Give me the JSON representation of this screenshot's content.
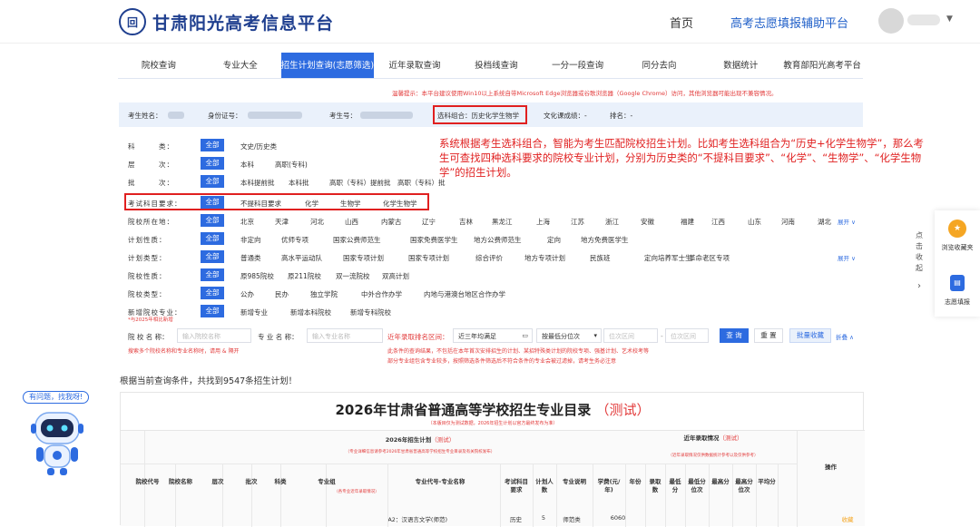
{
  "header": {
    "logo_glyph": "回",
    "title": "甘肃阳光高考信息平台",
    "nav": [
      "首页",
      "高考志愿填报辅助平台"
    ]
  },
  "tabs": [
    {
      "label": "院校查询",
      "active": false
    },
    {
      "label": "专业大全",
      "active": false
    },
    {
      "label": "招生计划查询(志愿筛选)",
      "active": true
    },
    {
      "label": "近年录取查询",
      "active": false
    },
    {
      "label": "投档线查询",
      "active": false
    },
    {
      "label": "一分一段查询",
      "active": false
    },
    {
      "label": "同分去向",
      "active": false
    },
    {
      "label": "数据统计",
      "active": false
    },
    {
      "label": "教育部阳光高考平台",
      "active": false
    }
  ],
  "notice": "温馨提示：本平台建议使用Win10以上系统自带Microsoft Edge浏览器或谷歌浏览器（Google Chrome）访问，其他浏览器可能出现不兼容情况。",
  "student_info": {
    "name_label": "考生姓名：",
    "id_label": "身份证号：",
    "exam_label": "考生号：",
    "subject_combo": "选科组合：历史化学生物学",
    "culture_score": "文化课成绩：-",
    "rank": "排名：-"
  },
  "explanation": "系统根据考生选科组合，智能为考生匹配院校招生计划。比如考生选科组合为“历史+化学生物学”，那么考生可查找四种选科要求的院校专业计划，分别为历史类的“不提科目要求”、“化学”、“生物学”、“化学生物学”的招生计划。",
  "filters": [
    {
      "label": "科　　　类：",
      "all": "全部",
      "options": [
        "文史/历史类"
      ]
    },
    {
      "label": "层　　　次：",
      "all": "全部",
      "options": [
        "本科",
        "高职(专科)"
      ]
    },
    {
      "label": "批　　　次：",
      "all": "全部",
      "options": [
        "本科提前批",
        "本科批",
        "高职（专科）提前批",
        "高职（专科）批"
      ]
    },
    {
      "label": "考试科目要求：",
      "all": "全部",
      "options": [
        "不提科目要求",
        "化学",
        "生物学",
        "化学生物学"
      ]
    },
    {
      "label": "院校所在地：",
      "all": "全部",
      "options": [
        "北京",
        "天津",
        "河北",
        "山西",
        "内蒙古",
        "辽宁",
        "吉林",
        "黑龙江",
        "上海",
        "江苏",
        "浙江",
        "安徽",
        "福建",
        "江西",
        "山东",
        "河南",
        "湖北"
      ],
      "more": "展开 ∨"
    },
    {
      "label": "计划性质：",
      "all": "全部",
      "options": [
        "非定向",
        "优师专项",
        "国家公费师范生",
        "国家免费医学生",
        "地方公费师范生",
        "定向",
        "地方免费医学生"
      ]
    },
    {
      "label": "计划类型：",
      "all": "全部",
      "options": [
        "普通类",
        "高水平运动队",
        "国家专项计划",
        "国家专项计划",
        "综合评价",
        "地方专项计划",
        "民族班",
        "定向培养军士生",
        "革命老区专项"
      ],
      "more": "展开 ∨"
    },
    {
      "label": "院校性质：",
      "all": "全部",
      "options": [
        "原985院校",
        "原211院校",
        "双一流院校",
        "双高计划"
      ]
    },
    {
      "label": "院校类型：",
      "all": "全部",
      "options": [
        "公办",
        "民办",
        "独立学院",
        "中外合作办学",
        "内地与港澳台地区合作办学"
      ]
    },
    {
      "label": "新增院校专业：",
      "all": "全部",
      "options": [
        "新增专业",
        "新增本科院校",
        "新增专科院校"
      ]
    }
  ],
  "filter_sub_note": "*与2025年相比新增",
  "search": {
    "school_label": "院 校 名 称：",
    "school_placeholder": "输入院校名称",
    "major_label": "专 业 名 称：",
    "major_placeholder": "输入专业名称",
    "range_label": "近年录取排名区间：",
    "range_value": "近三年均满足",
    "sort_value": "按最低分位次",
    "rank_placeholder": "位次区间",
    "rank_placeholder2": "位次区间",
    "query": "查 询",
    "reset": "重 置",
    "batch": "批量收藏",
    "collapse": "折叠 ∧",
    "hint1": "搜索多个院校名称和专业名称时，请用 & 隔开",
    "hint2": "此条件的查询结果，不包括在本年首次安排招生的计划、某招特殊类计划的院校专项、强基计划、艺术校考等",
    "hint3": "部分专业组包含专业较多，按照筛选条件筛选后不符合条件的专业会被过滤掉，请考生务必注意"
  },
  "result_text": "根据当前查询条件，共找到9547条招生计划！",
  "table": {
    "title": "2026年甘肃省普通高等学校招生专业目录",
    "title_test": "（测试）",
    "subtitle": "（本版目仅为测试数据，2026年招生计划以官方最终发布为准）",
    "plan_header": "2026年招生计划",
    "plan_header_test": "（测试）",
    "plan_note": "（专业详细信息请参考2026年甘肃省普通高等学校招生专业目录及有关院校发布）",
    "recent_header": "近年录取情况",
    "recent_header_test": "（测试）",
    "recent_note": "（近年录取情况仅供数据统计参考以及仅供参考）",
    "major_group_note": "（各专业近年录取情况）",
    "operation": "操作",
    "columns": [
      "院校代号",
      "院校名称",
      "层次",
      "批次",
      "科类",
      "专业组",
      "专业代号-专业名称",
      "考试科目要求",
      "计划人数",
      "专业说明",
      "学费(元/年)",
      "年份",
      "录取数",
      "最低分",
      "最低分位次",
      "最高分",
      "最高分位次",
      "平均分"
    ],
    "row": {
      "major": "A2：汉语言文学(师范)",
      "subject": "历史",
      "count": "5",
      "note": "师范类",
      "fee": "6060",
      "action": "收藏"
    }
  },
  "side": {
    "text": "点击收起",
    "collect": "浏览收藏夹",
    "fill": "志愿填报",
    "collect_icon": "star-icon",
    "fill_icon": "document-icon"
  },
  "robot_bubble": "有问题，找我呀!",
  "colors": {
    "primary": "#2d6be0",
    "brand": "#1f3f8f",
    "alert": "#e02020"
  }
}
